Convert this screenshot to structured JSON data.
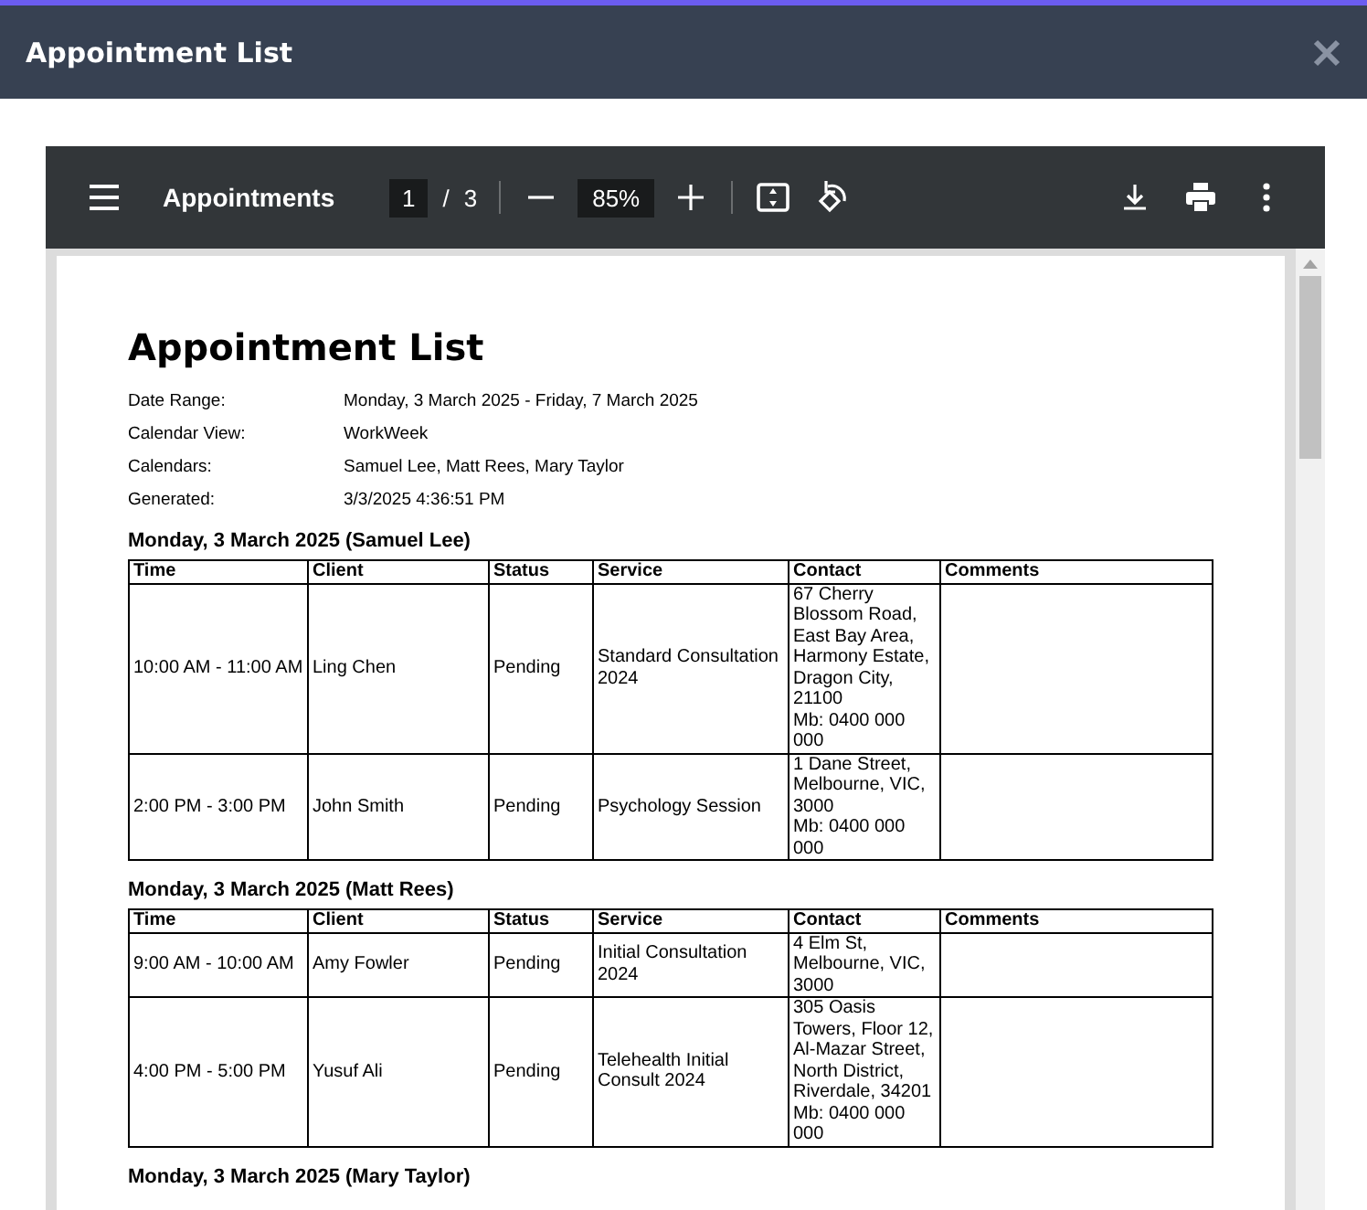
{
  "window": {
    "title": "Appointment List"
  },
  "viewer": {
    "document_title": "Appointments",
    "page": "1",
    "page_total": "3",
    "separator": "/",
    "zoom": "85%"
  },
  "document": {
    "title": "Appointment List",
    "meta": [
      {
        "label": "Date Range:",
        "value": "Monday, 3 March 2025 - Friday, 7 March 2025"
      },
      {
        "label": "Calendar View:",
        "value": "WorkWeek"
      },
      {
        "label": "Calendars:",
        "value": "Samuel Lee, Matt Rees, Mary Taylor"
      },
      {
        "label": "Generated:",
        "value": "3/3/2025 4:36:51 PM"
      }
    ],
    "sections": [
      {
        "heading": "Monday, 3 March 2025 (Samuel Lee)",
        "columns": [
          "Time",
          "Client",
          "Status",
          "Service",
          "Contact",
          "Comments"
        ],
        "rows": [
          [
            "10:00 AM - 11:00 AM",
            "Ling Chen",
            "Pending",
            "Standard Consultation 2024",
            "67 Cherry Blossom Road, East Bay Area, Harmony Estate, Dragon City, 21100\nMb: 0400 000 000",
            ""
          ],
          [
            "2:00 PM - 3:00 PM",
            "John Smith",
            "Pending",
            "Psychology Session",
            "1 Dane Street, Melbourne, VIC, 3000\nMb: 0400 000 000",
            ""
          ]
        ]
      },
      {
        "heading": "Monday, 3 March 2025 (Matt Rees)",
        "columns": [
          "Time",
          "Client",
          "Status",
          "Service",
          "Contact",
          "Comments"
        ],
        "rows": [
          [
            "9:00 AM - 10:00 AM",
            "Amy Fowler",
            "Pending",
            "Initial Consultation 2024",
            "4 Elm St, Melbourne, VIC, 3000",
            ""
          ],
          [
            "4:00 PM - 5:00 PM",
            "Yusuf Ali",
            "Pending",
            "Telehealth Initial Consult 2024",
            "305 Oasis Towers, Floor 12, Al-Mazar Street, North District, Riverdale, 34201\nMb: 0400 000 000",
            ""
          ]
        ]
      },
      {
        "heading": "Monday, 3 March 2025 (Mary Taylor)"
      }
    ]
  }
}
